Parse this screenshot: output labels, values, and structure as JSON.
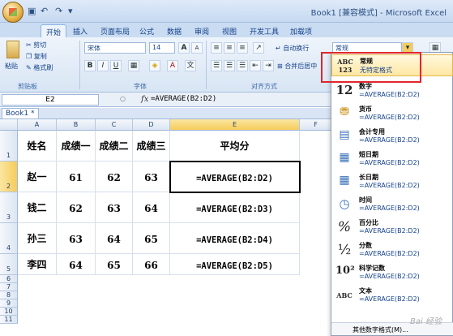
{
  "titlebar": {
    "title": "Book1 [兼容模式] - Microsoft Excel"
  },
  "tabs": [
    {
      "label": "开始"
    },
    {
      "label": "插入"
    },
    {
      "label": "页面布局"
    },
    {
      "label": "公式"
    },
    {
      "label": "数据"
    },
    {
      "label": "审阅"
    },
    {
      "label": "视图"
    },
    {
      "label": "开发工具"
    },
    {
      "label": "加载项"
    }
  ],
  "ribbon": {
    "clipboard": {
      "paste": "粘贴",
      "cut": "剪切",
      "copy": "复制",
      "format_painter": "格式刷",
      "label": "剪贴板"
    },
    "font": {
      "name": "宋体",
      "size": "14",
      "label": "字体",
      "bold": "B",
      "italic": "I",
      "underline": "U",
      "grow": "A",
      "shrink": "A"
    },
    "alignment": {
      "wrap": "自动换行",
      "merge": "合并后居中",
      "label": "对齐方式"
    },
    "number_format_value": "常规"
  },
  "formula_bar": {
    "name_box": "E2",
    "fx": "fx",
    "formula": "=AVERAGE(B2:D2)"
  },
  "workbook_tab": "Book1 *",
  "columns": [
    "A",
    "B",
    "C",
    "D",
    "E",
    "F"
  ],
  "rows": [
    "1",
    "2",
    "3",
    "4",
    "5",
    "6",
    "7",
    "8",
    "9",
    "10",
    "11"
  ],
  "sheet": {
    "header": [
      "姓名",
      "成绩一",
      "成绩二",
      "成绩三",
      "平均分"
    ],
    "data": [
      [
        "赵一",
        "61",
        "62",
        "63",
        "=AVERAGE(B2:D2)"
      ],
      [
        "钱二",
        "62",
        "63",
        "64",
        "=AVERAGE(B2:D3)"
      ],
      [
        "孙三",
        "63",
        "64",
        "65",
        "=AVERAGE(B2:D4)"
      ],
      [
        "李四",
        "64",
        "65",
        "66",
        "=AVERAGE(B2:D5)"
      ]
    ]
  },
  "number_formats": [
    {
      "icon": "ABC 123",
      "name": "常规",
      "value": "无特定格式",
      "highlighted": true
    },
    {
      "icon": "12",
      "name": "数字",
      "value": "=AVERAGE(B2:D2)"
    },
    {
      "icon": "coins-icon",
      "name": "货币",
      "value": "=AVERAGE(B2:D2)"
    },
    {
      "icon": "ledger-icon",
      "name": "会计专用",
      "value": "=AVERAGE(B2:D2)"
    },
    {
      "icon": "calendar-icon",
      "name": "短日期",
      "value": "=AVERAGE(B2:D2)"
    },
    {
      "icon": "calendar-icon",
      "name": "长日期",
      "value": "=AVERAGE(B2:D2)"
    },
    {
      "icon": "clock-icon",
      "name": "时间",
      "value": "=AVERAGE(B2:D2)"
    },
    {
      "icon": "%",
      "name": "百分比",
      "value": "=AVERAGE(B2:D2)"
    },
    {
      "icon": "½",
      "name": "分数",
      "value": "=AVERAGE(B2:D2)"
    },
    {
      "icon": "10²",
      "name": "科学记数",
      "value": "=AVERAGE(B2:D2)"
    },
    {
      "icon": "ABC",
      "name": "文本",
      "value": "=AVERAGE(B2:D2)"
    }
  ],
  "more_formats": "其他数字格式(M)...",
  "watermark": "Bai 经验"
}
